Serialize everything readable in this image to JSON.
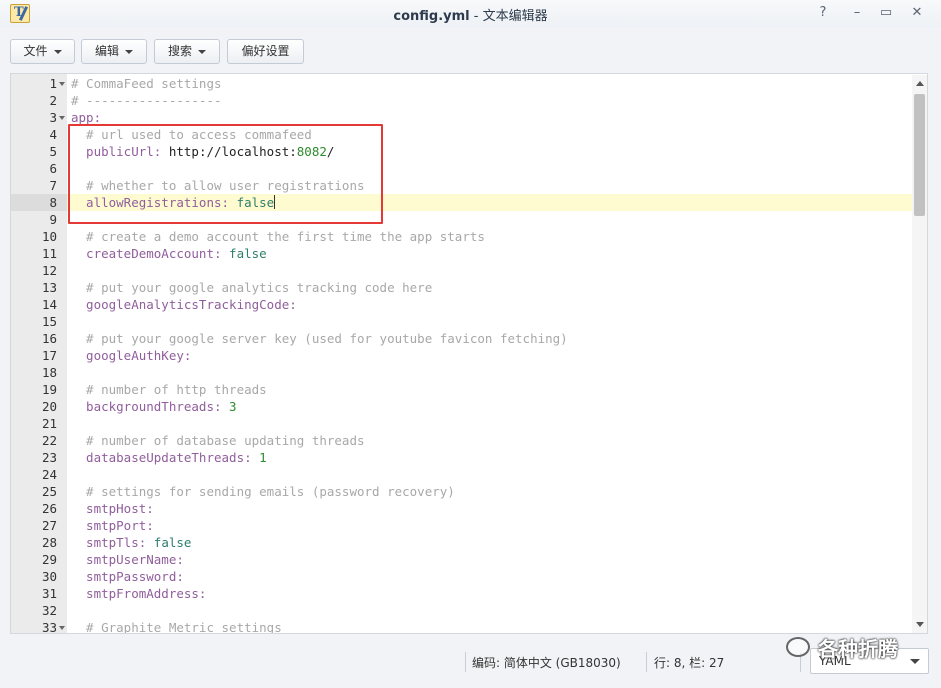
{
  "window": {
    "filename": "config.yml",
    "separator": " - ",
    "app_name": "文本编辑器",
    "help_icon": "?",
    "minimize_icon": "–",
    "maximize_icon": "▭",
    "close_icon": "✕"
  },
  "toolbar": {
    "file_label": "文件",
    "edit_label": "编辑",
    "search_label": "搜索",
    "prefs_label": "偏好设置"
  },
  "editor": {
    "active_line": 8,
    "lines": [
      {
        "n": "1",
        "fold": true,
        "tokens": [
          {
            "t": "# CommaFeed settings",
            "c": "comment"
          }
        ]
      },
      {
        "n": "2",
        "tokens": [
          {
            "t": "# ------------------",
            "c": "comment"
          }
        ]
      },
      {
        "n": "3",
        "fold": true,
        "tokens": [
          {
            "t": "app:",
            "c": "key"
          }
        ]
      },
      {
        "n": "4",
        "tokens": [
          {
            "t": "  # url used to access commafeed",
            "c": "comment"
          }
        ]
      },
      {
        "n": "5",
        "tokens": [
          {
            "t": "  publicUrl:",
            "c": "key"
          },
          {
            "t": " http://localhost:",
            "c": "url"
          },
          {
            "t": "8082",
            "c": "num"
          },
          {
            "t": "/",
            "c": "url"
          }
        ]
      },
      {
        "n": "6",
        "tokens": []
      },
      {
        "n": "7",
        "tokens": [
          {
            "t": "  # whether to allow user registrations",
            "c": "comment"
          }
        ]
      },
      {
        "n": "8",
        "tokens": [
          {
            "t": "  allowRegistrations:",
            "c": "key"
          },
          {
            "t": " false",
            "c": "bool"
          }
        ],
        "cursor": true
      },
      {
        "n": "9",
        "tokens": []
      },
      {
        "n": "10",
        "tokens": [
          {
            "t": "  # create a demo account the first time the app starts",
            "c": "comment"
          }
        ]
      },
      {
        "n": "11",
        "tokens": [
          {
            "t": "  createDemoAccount:",
            "c": "key"
          },
          {
            "t": " false",
            "c": "bool"
          }
        ]
      },
      {
        "n": "12",
        "tokens": []
      },
      {
        "n": "13",
        "tokens": [
          {
            "t": "  # put your google analytics tracking code here",
            "c": "comment"
          }
        ]
      },
      {
        "n": "14",
        "tokens": [
          {
            "t": "  googleAnalyticsTrackingCode:",
            "c": "key"
          }
        ]
      },
      {
        "n": "15",
        "tokens": []
      },
      {
        "n": "16",
        "tokens": [
          {
            "t": "  # put your google server key (used for youtube favicon fetching)",
            "c": "comment"
          }
        ]
      },
      {
        "n": "17",
        "tokens": [
          {
            "t": "  googleAuthKey:",
            "c": "key"
          }
        ]
      },
      {
        "n": "18",
        "tokens": []
      },
      {
        "n": "19",
        "tokens": [
          {
            "t": "  # number of http threads",
            "c": "comment"
          }
        ]
      },
      {
        "n": "20",
        "tokens": [
          {
            "t": "  backgroundThreads:",
            "c": "key"
          },
          {
            "t": " 3",
            "c": "num"
          }
        ]
      },
      {
        "n": "21",
        "tokens": []
      },
      {
        "n": "22",
        "tokens": [
          {
            "t": "  # number of database updating threads",
            "c": "comment"
          }
        ]
      },
      {
        "n": "23",
        "tokens": [
          {
            "t": "  databaseUpdateThreads:",
            "c": "key"
          },
          {
            "t": " 1",
            "c": "num"
          }
        ]
      },
      {
        "n": "24",
        "tokens": []
      },
      {
        "n": "25",
        "tokens": [
          {
            "t": "  # settings for sending emails (password recovery)",
            "c": "comment"
          }
        ]
      },
      {
        "n": "26",
        "tokens": [
          {
            "t": "  smtpHost:",
            "c": "key"
          }
        ]
      },
      {
        "n": "27",
        "tokens": [
          {
            "t": "  smtpPort:",
            "c": "key"
          }
        ]
      },
      {
        "n": "28",
        "tokens": [
          {
            "t": "  smtpTls:",
            "c": "key"
          },
          {
            "t": " false",
            "c": "bool"
          }
        ]
      },
      {
        "n": "29",
        "tokens": [
          {
            "t": "  smtpUserName:",
            "c": "key"
          }
        ]
      },
      {
        "n": "30",
        "tokens": [
          {
            "t": "  smtpPassword:",
            "c": "key"
          }
        ]
      },
      {
        "n": "31",
        "tokens": [
          {
            "t": "  smtpFromAddress:",
            "c": "key"
          }
        ]
      },
      {
        "n": "32",
        "tokens": []
      },
      {
        "n": "33",
        "fold": true,
        "tokens": [
          {
            "t": "  # Graphite Metric settings",
            "c": "comment"
          }
        ]
      }
    ]
  },
  "status": {
    "encoding": "编码: 简体中文 (GB18030)",
    "position": "行: 8, 栏: 27",
    "language": "YAML"
  },
  "watermark": {
    "text": "各种折腾"
  },
  "colors": {
    "comment": "#a8a8a8",
    "key": "#905e9c",
    "number": "#2e8b2e",
    "boolean": "#2e7f6a",
    "active_line": "#fffbd1",
    "highlight_box": "#e53935"
  }
}
